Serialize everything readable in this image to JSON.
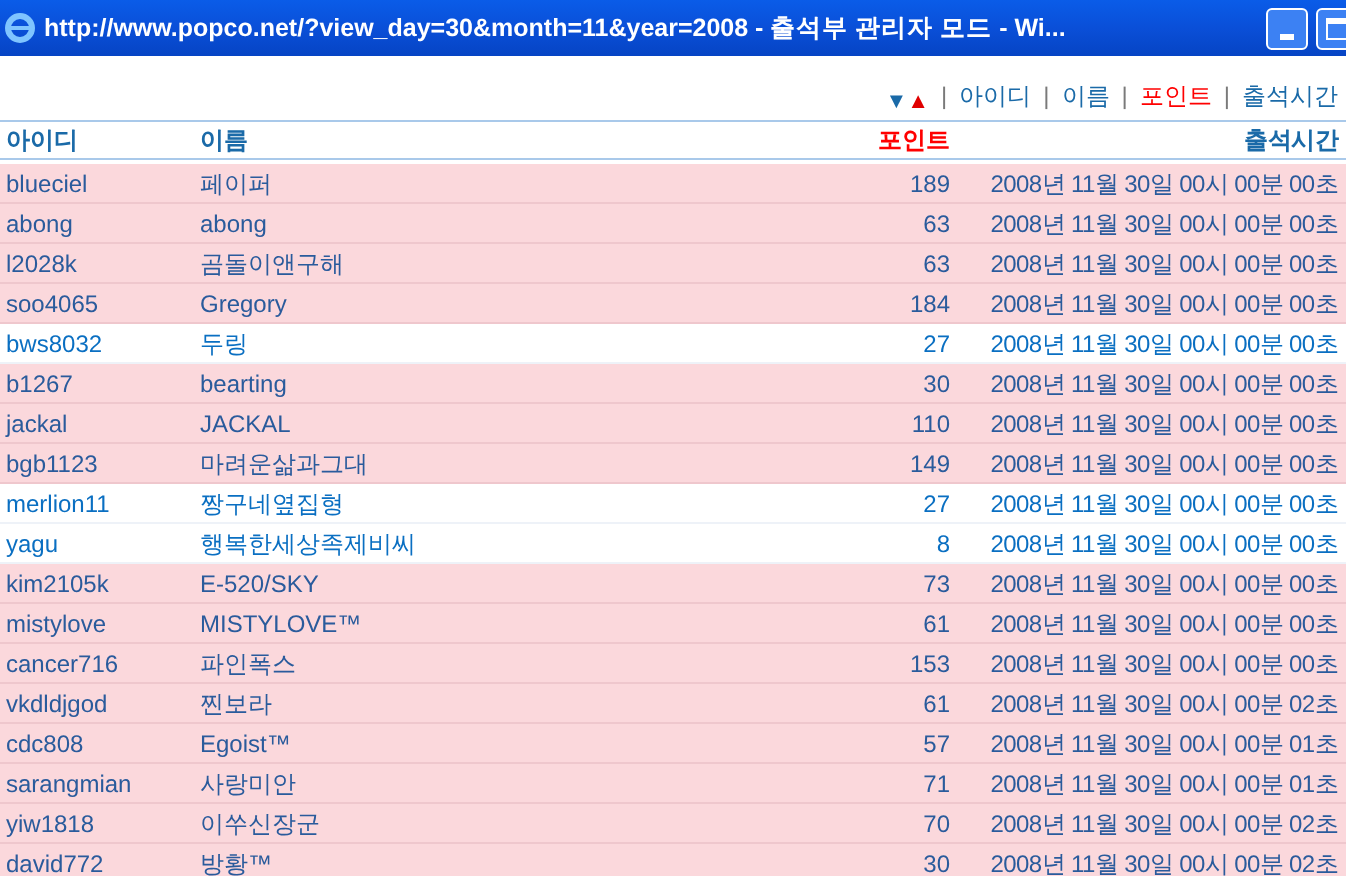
{
  "window": {
    "title": "http://www.popco.net/?view_day=30&month=11&year=2008 - 출석부 관리자 모드 - Wi..."
  },
  "sort_bar": {
    "arrows": "▼▲",
    "separator": "|",
    "links": [
      {
        "label": "아이디",
        "selected": false
      },
      {
        "label": "이름",
        "selected": false
      },
      {
        "label": "포인트",
        "selected": true
      },
      {
        "label": "출석시간",
        "selected": false
      }
    ]
  },
  "table": {
    "columns": [
      {
        "label": "아이디",
        "selected": false
      },
      {
        "label": "이름",
        "selected": false
      },
      {
        "label": "포인트",
        "selected": true
      },
      {
        "label": "출석시간",
        "selected": false
      }
    ],
    "rows": [
      {
        "id": "blueciel",
        "name": "페이퍼",
        "points": "189",
        "time": "2008년 11월 30일 00시 00분 00초",
        "highlighted": true
      },
      {
        "id": "abong",
        "name": "abong",
        "points": "63",
        "time": "2008년 11월 30일 00시 00분 00초",
        "highlighted": true
      },
      {
        "id": "l2028k",
        "name": "곰돌이앤구해",
        "points": "63",
        "time": "2008년 11월 30일 00시 00분 00초",
        "highlighted": true
      },
      {
        "id": "soo4065",
        "name": "Gregory",
        "points": "184",
        "time": "2008년 11월 30일 00시 00분 00초",
        "highlighted": true
      },
      {
        "id": "bws8032",
        "name": "두링",
        "points": "27",
        "time": "2008년 11월 30일 00시 00분 00초",
        "highlighted": false
      },
      {
        "id": "b1267",
        "name": "bearting",
        "points": "30",
        "time": "2008년 11월 30일 00시 00분 00초",
        "highlighted": true
      },
      {
        "id": "jackal",
        "name": "JACKAL",
        "points": "110",
        "time": "2008년 11월 30일 00시 00분 00초",
        "highlighted": true
      },
      {
        "id": "bgb1123",
        "name": "마려운삶과그대",
        "points": "149",
        "time": "2008년 11월 30일 00시 00분 00초",
        "highlighted": true
      },
      {
        "id": "merlion11",
        "name": "짱구네옆집형",
        "points": "27",
        "time": "2008년 11월 30일 00시 00분 00초",
        "highlighted": false
      },
      {
        "id": "yagu",
        "name": "행복한세상족제비씨",
        "points": "8",
        "time": "2008년 11월 30일 00시 00분 00초",
        "highlighted": false
      },
      {
        "id": "kim2105k",
        "name": "E-520/SKY",
        "points": "73",
        "time": "2008년 11월 30일 00시 00분 00초",
        "highlighted": true
      },
      {
        "id": "mistylove",
        "name": "MISTYLOVE™",
        "points": "61",
        "time": "2008년 11월 30일 00시 00분 00초",
        "highlighted": true
      },
      {
        "id": "cancer716",
        "name": "파인폭스",
        "points": "153",
        "time": "2008년 11월 30일 00시 00분 00초",
        "highlighted": true
      },
      {
        "id": "vkdldjgod",
        "name": "찐보라",
        "points": "61",
        "time": "2008년 11월 30일 00시 00분 02초",
        "highlighted": true
      },
      {
        "id": "cdc808",
        "name": "Egoist™",
        "points": "57",
        "time": "2008년 11월 30일 00시 00분 01초",
        "highlighted": true
      },
      {
        "id": "sarangmian",
        "name": "사랑미안",
        "points": "71",
        "time": "2008년 11월 30일 00시 00분 01초",
        "highlighted": true
      },
      {
        "id": "yiw1818",
        "name": "이쑤신장군",
        "points": "70",
        "time": "2008년 11월 30일 00시 00분 02초",
        "highlighted": true
      },
      {
        "id": "david772",
        "name": "방황™",
        "points": "30",
        "time": "2008년 11월 30일 00시 00분 02초",
        "highlighted": true
      }
    ]
  }
}
